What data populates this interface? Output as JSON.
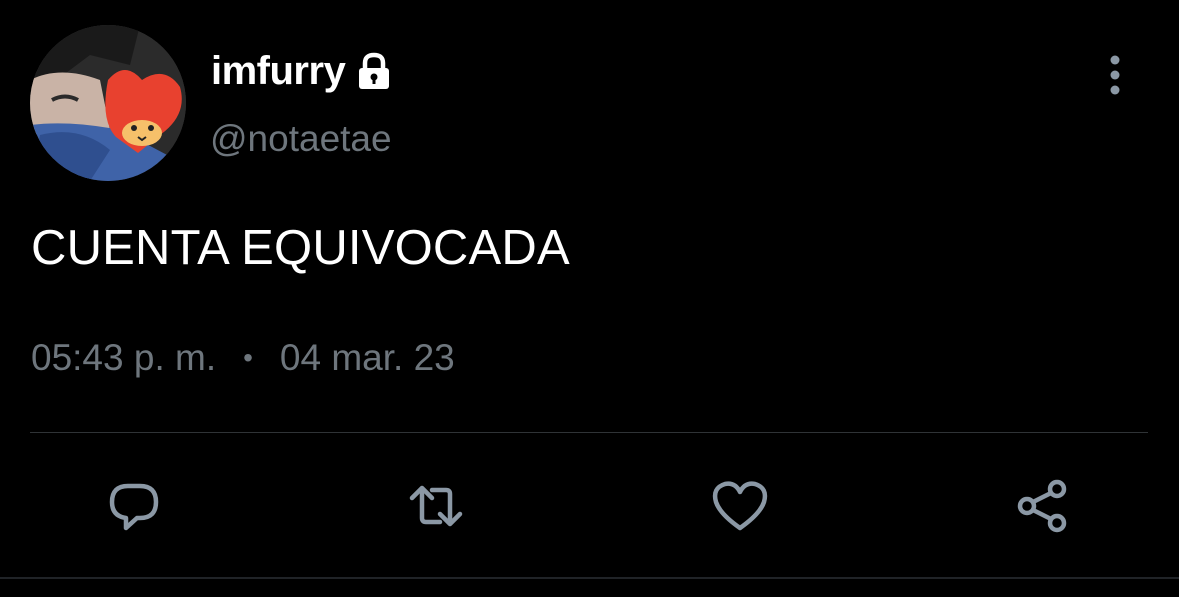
{
  "user": {
    "display_name": "imfurry",
    "handle": "@notaetae",
    "protected_icon": "lock-icon"
  },
  "tweet": {
    "text": "CUENTA EQUIVOCADA",
    "time": "05:43 p. m.",
    "separator": "•",
    "date": "04 mar. 23"
  },
  "actions": [
    {
      "icon": "reply-icon"
    },
    {
      "icon": "retweet-icon"
    },
    {
      "icon": "like-icon"
    },
    {
      "icon": "share-icon"
    }
  ],
  "colors": {
    "background": "#000000",
    "text_primary": "#ffffff",
    "text_secondary": "#6e767d",
    "divider": "#2f3336"
  }
}
